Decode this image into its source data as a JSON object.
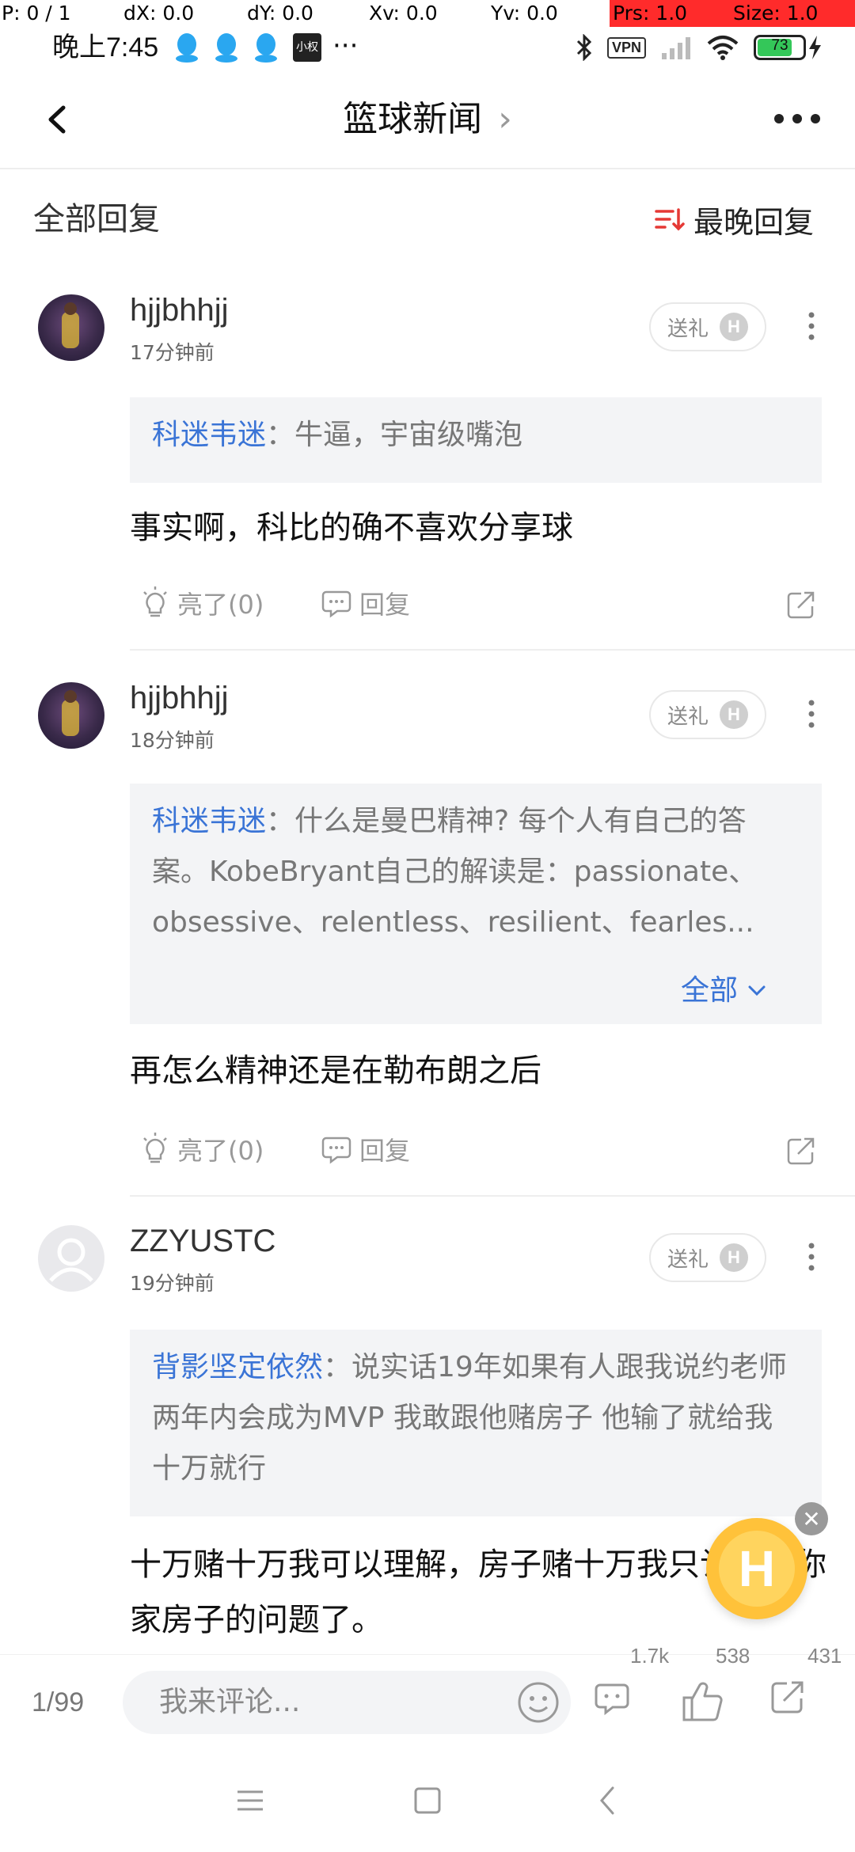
{
  "debug": {
    "p": "P: 0 / 1",
    "dx": "dX: 0.0",
    "dy": "dY: 0.0",
    "xv": "Xv: 0.0",
    "yv": "Yv: 0.0",
    "prs": "Prs: 1.0",
    "size": "Size: 1.0"
  },
  "status_bar": {
    "time": "晚上7:45",
    "app_badge": "小权",
    "more": "···",
    "vpn": "VPN",
    "battery": "73"
  },
  "nav": {
    "title": "篮球新闻",
    "title_chevron": "›"
  },
  "section": {
    "title": "全部回复",
    "sort_label": "最晚回复"
  },
  "comments": [
    {
      "username": "hjjbhhjj",
      "time": "17分钟前",
      "gift": "送礼",
      "quote_name": "科迷韦迷",
      "quote_text": "：牛逼，宇宙级嘴泡",
      "text": "事实啊，科比的确不喜欢分享球",
      "like": "亮了(0)",
      "reply": "回复"
    },
    {
      "username": "hjjbhhjj",
      "time": "18分钟前",
      "gift": "送礼",
      "quote_name": "科迷韦迷",
      "quote_text": "：什么是曼巴精神? 每个人有自己的答案。KobeBryant自己的解读是：passionate、obsessive、relentless、resilient、fearles...",
      "expand": "全部",
      "text": "再怎么精神还是在勒布朗之后",
      "like": "亮了(0)",
      "reply": "回复"
    },
    {
      "username": "ZZYUSTC",
      "time": "19分钟前",
      "gift": "送礼",
      "quote_name": "背影坚定依然",
      "quote_text": "：说实话19年如果有人跟我说约老师两年内会成为MVP 我敢跟他赌房子 他输了就给我十万就行",
      "text": "十万赌十万我可以理解，房子赌十万我只认为是你家房子的问题了。"
    }
  ],
  "bottom_bar": {
    "page": "1/99",
    "placeholder": "我来评论...",
    "comment_count": "1.7k",
    "like_count": "538",
    "share_count": "431"
  },
  "gift_badge_letter": "H",
  "float_badge_letter": "H",
  "colors": {
    "accent_blue": "#3a74d6",
    "sort_red": "#e53935",
    "float_gold": "#ffc23a"
  }
}
